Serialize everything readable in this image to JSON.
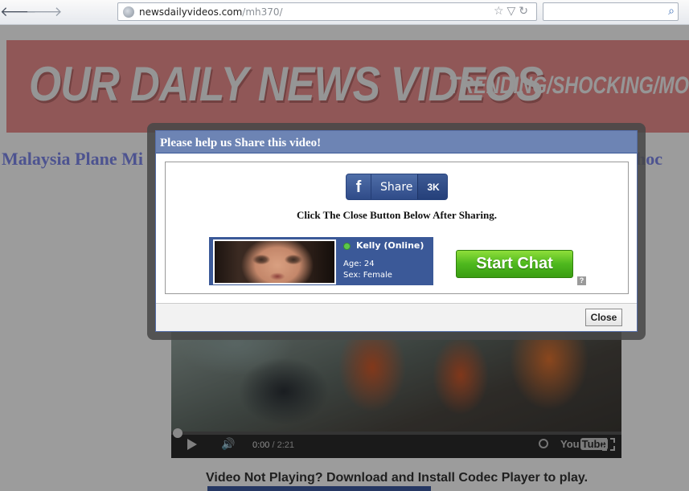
{
  "browser": {
    "url_domain": "newsdailyvideos.com",
    "url_path": "/mh370/",
    "back_icon": "back-arrow-icon",
    "forward_icon": "forward-arrow-icon",
    "search_value": ""
  },
  "banner": {
    "title": "OUR DAILY NEWS VIDEOS",
    "subtitle": "TRENDING/SHOCKING/MOST CONTRO",
    "background": "#e98d8d"
  },
  "headline": {
    "left": "Malaysia Plane Mi",
    "right": "e. Shoc"
  },
  "video": {
    "current_time": "0:00",
    "duration": "/ 2:21",
    "logo_you": "You",
    "logo_tube": "Tube",
    "progress": 0
  },
  "codec_text": "Video Not Playing? Download and Install Codec Player to play.",
  "modal": {
    "title": "Please help us Share this video!",
    "share_button": {
      "icon": "f",
      "label": "Share",
      "count": "3K"
    },
    "instruction": "Click The Close Button Below After Sharing.",
    "profile": {
      "name": "Kelly (Online)",
      "age": "Age: 24",
      "sex": "Sex: Female"
    },
    "start_chat_label": "Start Chat",
    "help_label": "?",
    "close_label": "Close",
    "header_color": "#6d84b4",
    "chat_color": "#4eb81e"
  }
}
